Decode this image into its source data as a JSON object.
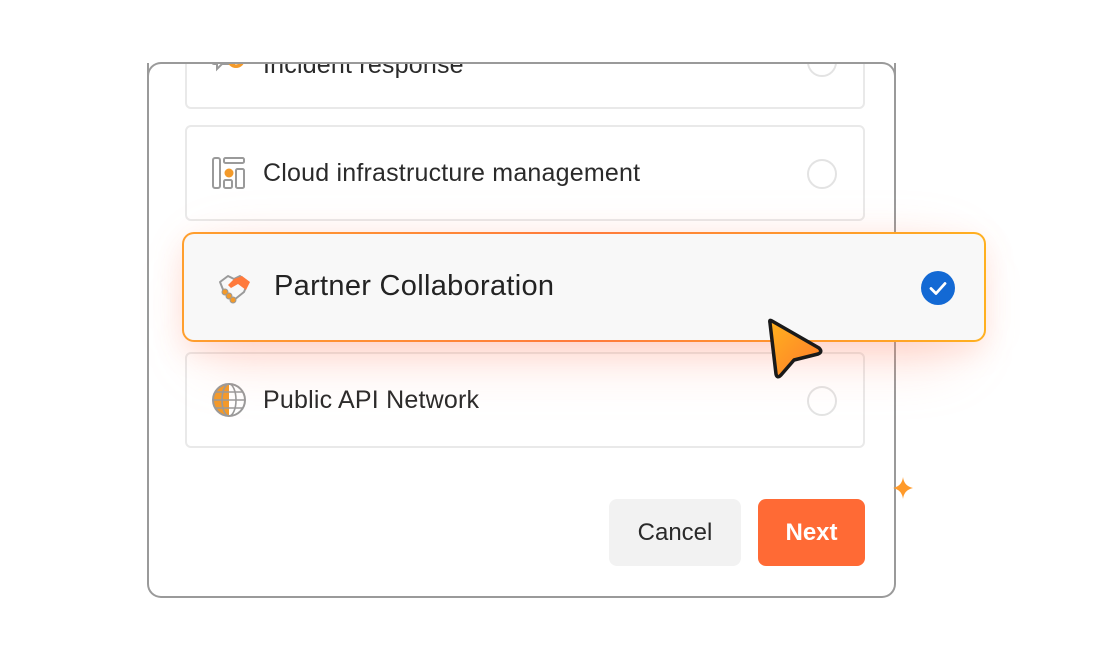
{
  "options": [
    {
      "label": "Incident response",
      "icon": "incident-chat-alert-icon",
      "selected": false
    },
    {
      "label": "Cloud infrastructure management",
      "icon": "server-rack-icon",
      "selected": false
    },
    {
      "label": "Partner Collaboration",
      "icon": "handshake-icon",
      "selected": true
    },
    {
      "label": "Public API Network",
      "icon": "globe-icon",
      "selected": false
    }
  ],
  "footer": {
    "cancel_label": "Cancel",
    "next_label": "Next"
  },
  "colors": {
    "accent": "#ff6a35",
    "check": "#1369d4",
    "selected_border_start": "#ff9f2e",
    "selected_border_end": "#ffb020"
  }
}
